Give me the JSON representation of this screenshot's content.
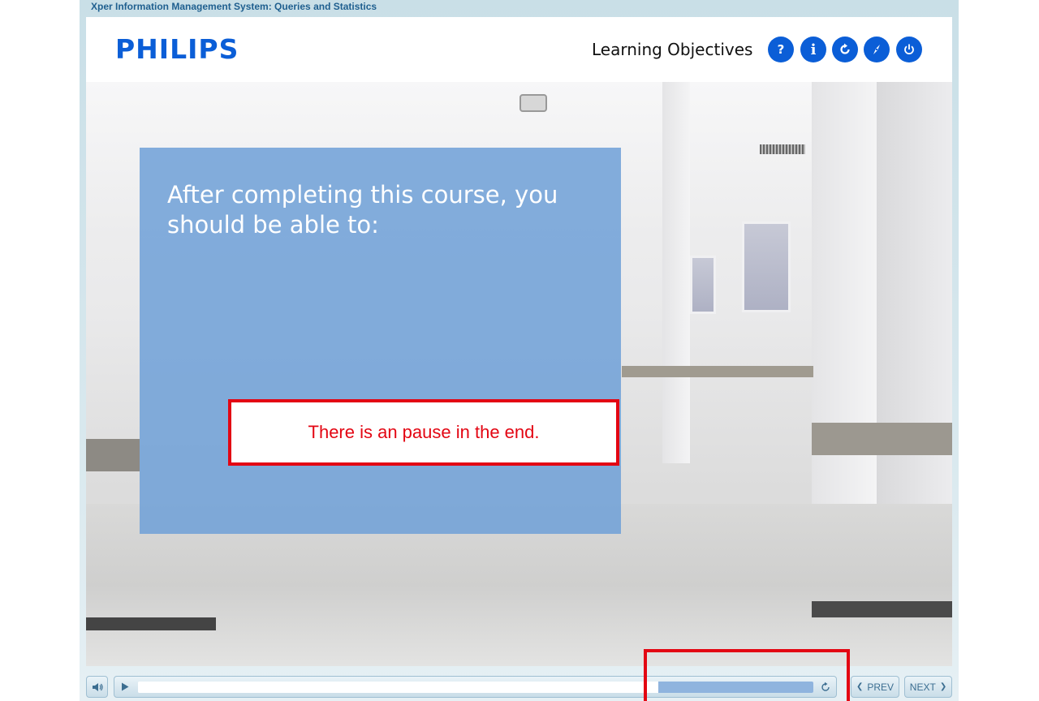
{
  "window": {
    "title": "Xper Information Management System: Queries and Statistics"
  },
  "header": {
    "logo": "PHILIPS",
    "section_title": "Learning Objectives",
    "buttons": [
      {
        "icon": "help-icon",
        "glyph": "?"
      },
      {
        "icon": "info-icon",
        "glyph": "i"
      },
      {
        "icon": "replay-icon",
        "glyph": ""
      },
      {
        "icon": "compass-icon",
        "glyph": ""
      },
      {
        "icon": "power-icon",
        "glyph": ""
      }
    ],
    "accent_color": "#0b5ed7"
  },
  "content": {
    "heading": "After completing this course, you should be able to:",
    "box_color": "#6ea0d7"
  },
  "annotation": {
    "note": "There is an pause in the end.",
    "color": "#e30613"
  },
  "controls": {
    "mute_icon": "speaker-icon",
    "play_icon": "play-icon",
    "replay_icon": "replay-icon",
    "progress_fraction": 0.77,
    "prev_label": "PREV",
    "next_label": "NEXT"
  }
}
